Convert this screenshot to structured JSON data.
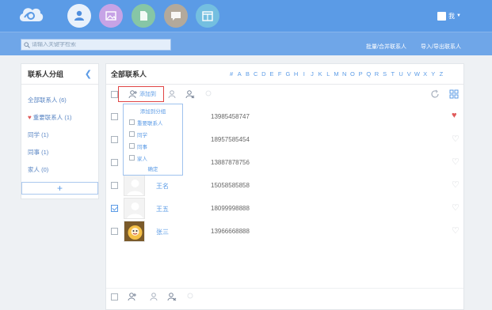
{
  "header": {
    "user_name": "我",
    "nav": [
      {
        "name": "contacts",
        "active": true
      },
      {
        "name": "photos",
        "active": false
      },
      {
        "name": "files",
        "active": false
      },
      {
        "name": "messages",
        "active": false
      },
      {
        "name": "calendar",
        "active": false
      }
    ]
  },
  "search": {
    "placeholder": "请输入关键字检索"
  },
  "subbar": {
    "merge_label": "批量/合并联系人",
    "import_export_label": "导入/导出联系人"
  },
  "groups": {
    "title": "联系人分组",
    "items": [
      {
        "label": "全部联系人 (6)",
        "favorite": false
      },
      {
        "label": "重要联系人 (1)",
        "favorite": true
      },
      {
        "label": "同学 (1)",
        "favorite": false
      },
      {
        "label": "同事 (1)",
        "favorite": false
      },
      {
        "label": "家人 (0)",
        "favorite": false
      }
    ],
    "add_label": "+"
  },
  "main": {
    "title": "全部联系人",
    "letters": [
      "#",
      "A",
      "B",
      "C",
      "D",
      "E",
      "F",
      "G",
      "H",
      "I",
      "J",
      "K",
      "L",
      "M",
      "N",
      "O",
      "P",
      "Q",
      "R",
      "S",
      "T",
      "U",
      "V",
      "W",
      "X",
      "Y",
      "Z"
    ],
    "add_to_label": "添加到",
    "dropdown": {
      "title": "添加到分组",
      "options": [
        "重要联系人",
        "同学",
        "同事",
        "家人"
      ],
      "confirm": "确定"
    },
    "contacts": [
      {
        "name": "",
        "phone": "13985458747",
        "favorite": true,
        "checked": false,
        "avatar": "none"
      },
      {
        "name": "",
        "phone": "18957585454",
        "favorite": false,
        "checked": false,
        "avatar": "none"
      },
      {
        "name": "",
        "phone": "13887878756",
        "favorite": false,
        "checked": false,
        "avatar": "none"
      },
      {
        "name": "王名",
        "phone": "15058585858",
        "favorite": false,
        "checked": false,
        "avatar": "default"
      },
      {
        "name": "王五",
        "phone": "18099998888",
        "favorite": false,
        "checked": true,
        "avatar": "default"
      },
      {
        "name": "张三",
        "phone": "13966668888",
        "favorite": false,
        "checked": false,
        "avatar": "photo"
      }
    ]
  },
  "colors": {
    "accent": "#5b9be6",
    "topbar": "#5b9be6",
    "favorite": "#e05a5a",
    "highlight_border": "#e04545"
  }
}
